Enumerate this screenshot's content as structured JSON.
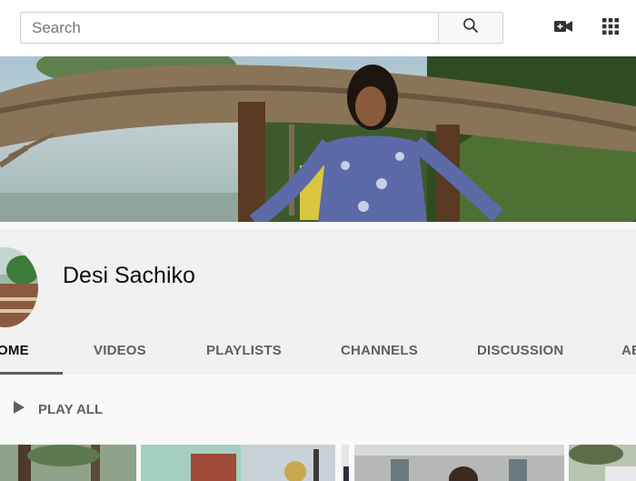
{
  "search": {
    "placeholder": "Search"
  },
  "header_icons": [
    "search-icon",
    "video-camera-icon",
    "apps-grid-icon"
  ],
  "channel": {
    "name": "Desi Sachiko"
  },
  "tabs": [
    {
      "label": "OME"
    },
    {
      "label": "VIDEOS"
    },
    {
      "label": "PLAYLISTS"
    },
    {
      "label": "CHANNELS"
    },
    {
      "label": "DISCUSSION"
    },
    {
      "label": "AB"
    }
  ],
  "play_all": {
    "label": "PLAY ALL"
  }
}
